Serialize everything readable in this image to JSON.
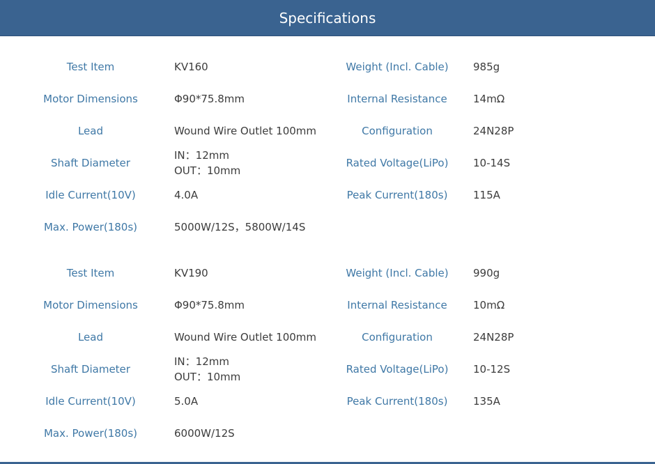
{
  "header": {
    "title": "Specifications"
  },
  "tables": [
    {
      "rows": [
        {
          "l1": "Test Item",
          "v1": "KV160",
          "l2": "Weight (Incl. Cable)",
          "v2": "985g"
        },
        {
          "l1": "Motor Dimensions",
          "v1": "Φ90*75.8mm",
          "l2": "Internal Resistance",
          "v2": "14mΩ"
        },
        {
          "l1": "Lead",
          "v1": "Wound Wire Outlet 100mm",
          "l2": "Configuration",
          "v2": "24N28P"
        },
        {
          "l1": "Shaft Diameter",
          "v1a": "IN：12mm",
          "v1b": "OUT：10mm",
          "l2": "Rated Voltage(LiPo)",
          "v2": "10-14S"
        },
        {
          "l1": "Idle Current(10V)",
          "v1": "4.0A",
          "l2": "Peak Current(180s)",
          "v2": "115A"
        },
        {
          "l1": "Max. Power(180s)",
          "v1": "5000W/12S，5800W/14S"
        }
      ]
    },
    {
      "rows": [
        {
          "l1": "Test Item",
          "v1": "KV190",
          "l2": "Weight (Incl. Cable)",
          "v2": "990g"
        },
        {
          "l1": "Motor Dimensions",
          "v1": "Φ90*75.8mm",
          "l2": "Internal Resistance",
          "v2": "10mΩ"
        },
        {
          "l1": "Lead",
          "v1": "Wound Wire Outlet 100mm",
          "l2": "Configuration",
          "v2": "24N28P"
        },
        {
          "l1": "Shaft Diameter",
          "v1a": "IN：12mm",
          "v1b": "OUT：10mm",
          "l2": "Rated Voltage(LiPo)",
          "v2": "10-12S"
        },
        {
          "l1": "Idle Current(10V)",
          "v1": "5.0A",
          "l2": "Peak Current(180s)",
          "v2": "135A"
        },
        {
          "l1": "Max. Power(180s)",
          "v1": "6000W/12S"
        }
      ]
    }
  ]
}
